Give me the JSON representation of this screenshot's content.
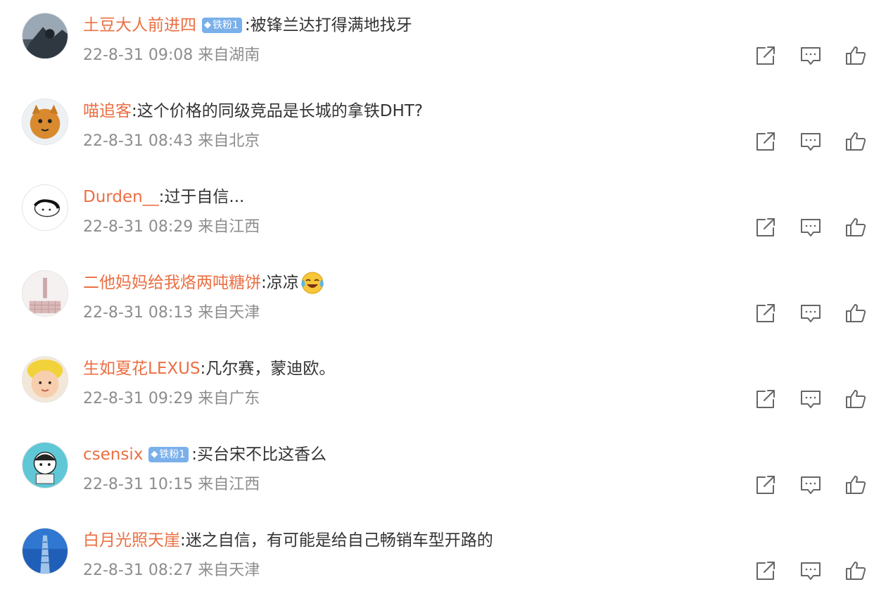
{
  "comments": [
    {
      "user": "土豆大人前进四",
      "badge": "铁粉1",
      "text": ":被锋兰达打得满地找牙",
      "time": "22-8-31 09:08",
      "location": "来自湖南"
    },
    {
      "user": "喵追客",
      "text": ":这个价格的同级竞品是长城的拿铁DHT?",
      "time": "22-8-31 08:43",
      "location": "来自北京"
    },
    {
      "user": "Durden__",
      "text": ":过于自信...",
      "time": "22-8-31 08:29",
      "location": "来自江西"
    },
    {
      "user": "二他妈妈给我烙两吨糖饼",
      "text": ":凉凉",
      "emoji": "tears-of-joy-emoji",
      "time": "22-8-31 08:13",
      "location": "来自天津"
    },
    {
      "user": "生如夏花LEXUS",
      "text": ":凡尔赛，蒙迪欧。",
      "time": "22-8-31 09:29",
      "location": "来自广东"
    },
    {
      "user": "csensix",
      "badge": "铁粉1",
      "text": ":买台宋不比这香么",
      "time": "22-8-31 10:15",
      "location": "来自江西"
    },
    {
      "user": "白月光照天崖",
      "text": ":迷之自信，有可能是给自己畅销车型开路的",
      "time": "22-8-31 08:27",
      "location": "来自天津"
    }
  ],
  "badge_icon": "diamond-icon",
  "action_icons": [
    "share-icon",
    "comment-icon",
    "like-icon"
  ],
  "colors": {
    "username": "#eb6f43",
    "badge": "#7ab0ea",
    "meta": "#8d8d8d",
    "text": "#333333"
  }
}
